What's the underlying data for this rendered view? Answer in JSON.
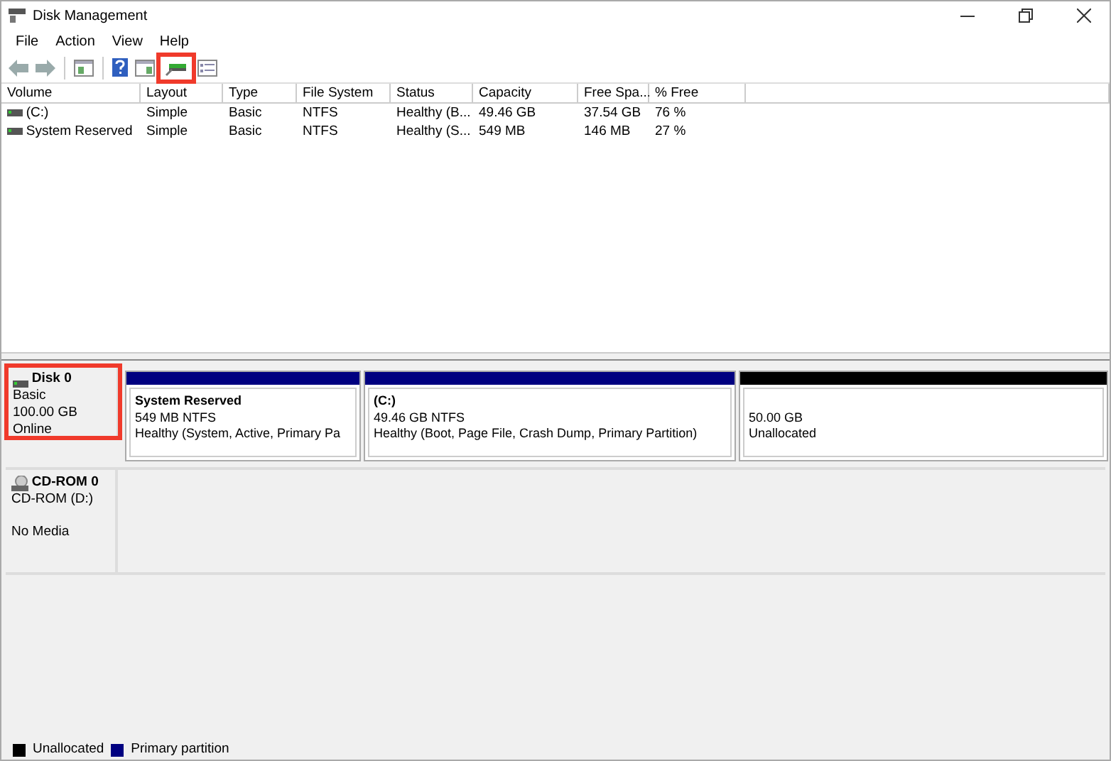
{
  "window": {
    "title": "Disk Management"
  },
  "menu": [
    "File",
    "Action",
    "View",
    "Help"
  ],
  "toolbar": [
    {
      "kind": "back",
      "highlighted": false
    },
    {
      "kind": "forward",
      "highlighted": false
    },
    {
      "kind": "sep"
    },
    {
      "kind": "pane",
      "highlighted": false
    },
    {
      "kind": "sep"
    },
    {
      "kind": "help",
      "highlighted": false
    },
    {
      "kind": "pane2",
      "highlighted": false
    },
    {
      "kind": "disk",
      "highlighted": true
    },
    {
      "kind": "list",
      "highlighted": false
    }
  ],
  "table": {
    "columns": [
      "Volume",
      "Layout",
      "Type",
      "File System",
      "Status",
      "Capacity",
      "Free Spa...",
      "% Free"
    ],
    "rows": [
      [
        "(C:)",
        "Simple",
        "Basic",
        "NTFS",
        "Healthy (B...",
        "49.46 GB",
        "37.54 GB",
        "76 %"
      ],
      [
        "System Reserved",
        "Simple",
        "Basic",
        "NTFS",
        "Healthy (S...",
        "549 MB",
        "146 MB",
        "27 %"
      ]
    ]
  },
  "disks": [
    {
      "kind": "disk",
      "name": "Disk 0",
      "lines": [
        "Basic",
        "100.00 GB",
        "Online"
      ],
      "highlighted": true,
      "partitions": [
        {
          "name": "System Reserved",
          "size": "549 MB NTFS",
          "status": "Healthy (System, Active, Primary Pa",
          "color": "#000080"
        },
        {
          "name": "(C:)",
          "size": "49.46 GB NTFS",
          "status": "Healthy (Boot, Page File, Crash Dump, Primary Partition)",
          "color": "#000080"
        },
        {
          "size": "50.00 GB",
          "status": "Unallocated",
          "color": "#000000"
        }
      ]
    },
    {
      "kind": "cdrom",
      "name": "CD-ROM 0",
      "lines": [
        "CD-ROM (D:)",
        "No Media"
      ],
      "highlighted": false
    }
  ],
  "legend": [
    {
      "label": "Unallocated",
      "color": "#000000"
    },
    {
      "label": "Primary partition",
      "color": "#000080"
    }
  ]
}
